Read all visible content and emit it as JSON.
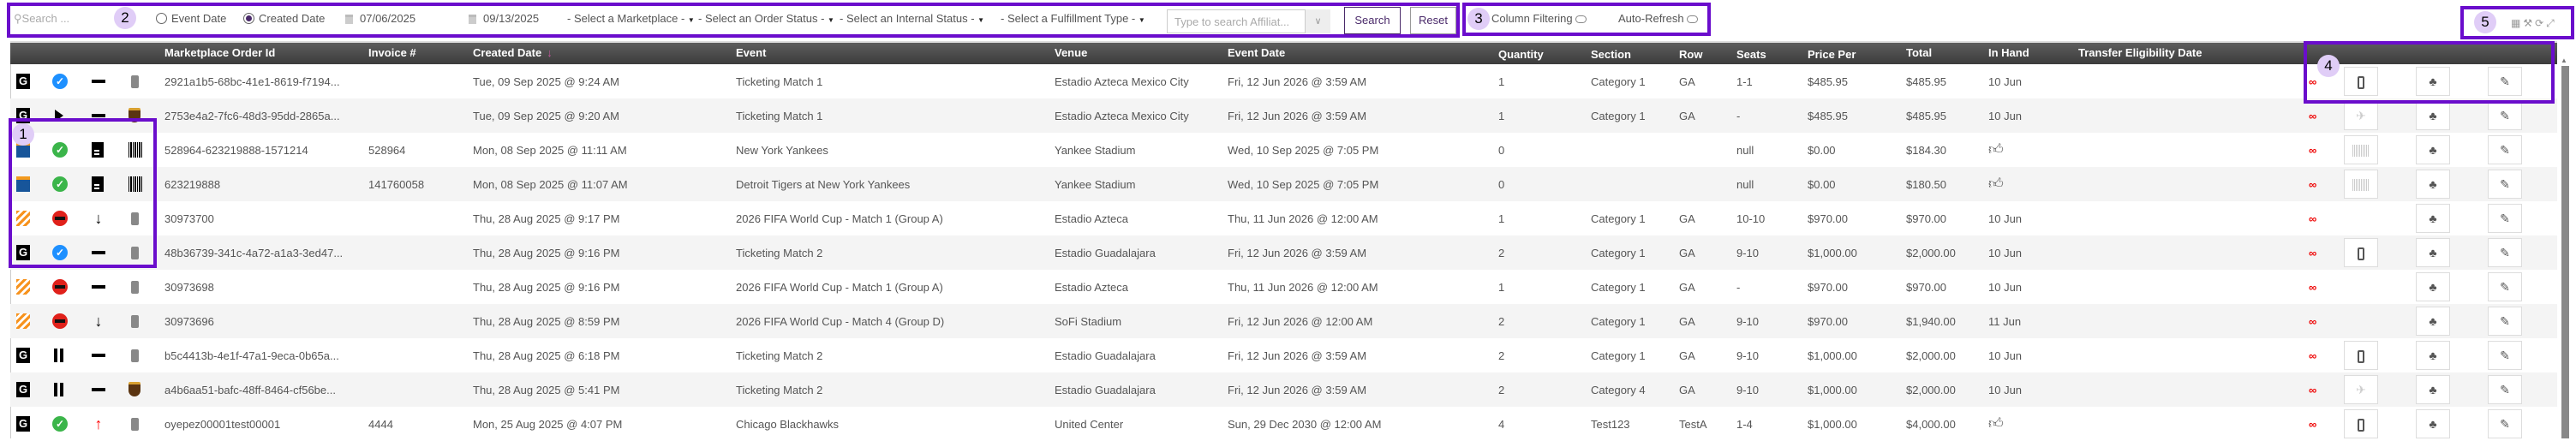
{
  "toolbar": {
    "search_placeholder": "Search ...",
    "date_type_options": [
      "Event Date",
      "Created Date"
    ],
    "date_type_selected": "Created Date",
    "date_from": "07/06/2025",
    "date_to": "09/13/2025",
    "marketplace_select": "- Select a Marketplace -",
    "order_status_select": "- Select an Order Status -",
    "internal_status_select": "- Select an Internal Status -",
    "fulfillment_type_select": "- Select a Fulfillment Type -",
    "affiliate_placeholder": "Type to search Affiliat...",
    "search_button": "Search",
    "reset_button": "Reset",
    "column_filtering_label": "Column Filtering",
    "auto_refresh_label": "Auto-Refresh",
    "tool_icons": [
      "excel-export-icon",
      "wrench-icon",
      "refresh-icon",
      "expand-icon"
    ]
  },
  "annotations": [
    "1",
    "2",
    "3",
    "4",
    "5"
  ],
  "colors": {
    "accent": "#6a0dcc",
    "header": "#4a4a4a",
    "sort": "#c0579a",
    "link": "#e00000"
  },
  "table": {
    "columns": [
      "Marketplace Order Id",
      "Invoice #",
      "Created Date",
      "Event",
      "Venue",
      "Event Date",
      "Quantity",
      "Section",
      "Row",
      "Seats",
      "Price Per",
      "Total",
      "In Hand",
      "Transfer Eligibility Date"
    ],
    "sort_column": "Created Date",
    "sort_direction": "desc",
    "rows": [
      {
        "icons": [
          "g",
          "check-blue",
          "dash",
          "phone"
        ],
        "order_id": "2921a1b5-68bc-41e1-8619-f7194...",
        "invoice": "",
        "created": "Tue, 09 Sep 2025 @ 9:24 AM",
        "event": "Ticketing Match 1",
        "venue": "Estadio Azteca Mexico City",
        "event_date": "Fri, 12 Jun 2026 @ 3:59 AM",
        "quantity": "1",
        "section": "Category 1",
        "row": "GA",
        "seats": "1-1",
        "price": "$485.95",
        "total": "$485.95",
        "in_hand": "10 Jun",
        "action": "phone"
      },
      {
        "icons": [
          "g",
          "play",
          "dash",
          "ups"
        ],
        "order_id": "2753e4a2-7fc6-48d3-95dd-2865a...",
        "invoice": "",
        "created": "Tue, 09 Sep 2025 @ 9:20 AM",
        "event": "Ticketing Match 1",
        "venue": "Estadio Azteca Mexico City",
        "event_date": "Fri, 12 Jun 2026 @ 3:59 AM",
        "quantity": "1",
        "section": "Category 1",
        "row": "GA",
        "seats": "-",
        "price": "$485.95",
        "total": "$485.95",
        "in_hand": "10 Jun",
        "action": "plane"
      },
      {
        "icons": [
          "tm",
          "check-green",
          "doc",
          "barcode"
        ],
        "order_id": "528964-623219888-1571214",
        "invoice": "528964",
        "created": "Mon, 08 Sep 2025 @ 11:11 AM",
        "event": "New York Yankees",
        "venue": "Yankee Stadium",
        "event_date": "Wed, 10 Sep 2025 @ 7:05 PM",
        "quantity": "0",
        "section": "",
        "row": "",
        "seats": "null",
        "price": "$0.00",
        "total": "$184.30",
        "in_hand": "thumbs-up",
        "action": "barcode"
      },
      {
        "icons": [
          "tm",
          "check-green",
          "doc",
          "barcode"
        ],
        "order_id": "623219888",
        "invoice": "141760058",
        "created": "Mon, 08 Sep 2025 @ 11:07 AM",
        "event": "Detroit Tigers at New York Yankees",
        "venue": "Yankee Stadium",
        "event_date": "Wed, 10 Sep 2025 @ 7:05 PM",
        "quantity": "0",
        "section": "",
        "row": "",
        "seats": "null",
        "price": "$0.00",
        "total": "$180.50",
        "in_hand": "thumbs-up",
        "action": "barcode"
      },
      {
        "icons": [
          "stripe",
          "stop-red",
          "arrow-down",
          "phone"
        ],
        "order_id": "30973700",
        "invoice": "",
        "created": "Thu, 28 Aug 2025 @ 9:17 PM",
        "event": "2026 FIFA World Cup - Match 1 (Group A)",
        "venue": "Estadio Azteca",
        "event_date": "Thu, 11 Jun 2026 @ 12:00 AM",
        "quantity": "1",
        "section": "Category 1",
        "row": "GA",
        "seats": "10-10",
        "price": "$970.00",
        "total": "$970.00",
        "in_hand": "10 Jun",
        "action": ""
      },
      {
        "icons": [
          "g",
          "check-blue",
          "dash",
          "phone"
        ],
        "order_id": "48b36739-341c-4a72-a1a3-3ed47...",
        "invoice": "",
        "created": "Thu, 28 Aug 2025 @ 9:16 PM",
        "event": "Ticketing Match 2",
        "venue": "Estadio Guadalajara",
        "event_date": "Fri, 12 Jun 2026 @ 3:59 AM",
        "quantity": "2",
        "section": "Category 1",
        "row": "GA",
        "seats": "9-10",
        "price": "$1,000.00",
        "total": "$2,000.00",
        "in_hand": "10 Jun",
        "action": "phone"
      },
      {
        "icons": [
          "stripe",
          "stop-red",
          "dash",
          "phone"
        ],
        "order_id": "30973698",
        "invoice": "",
        "created": "Thu, 28 Aug 2025 @ 9:16 PM",
        "event": "2026 FIFA World Cup - Match 1 (Group A)",
        "venue": "Estadio Azteca",
        "event_date": "Thu, 11 Jun 2026 @ 12:00 AM",
        "quantity": "1",
        "section": "Category 1",
        "row": "GA",
        "seats": "-",
        "price": "$970.00",
        "total": "$970.00",
        "in_hand": "10 Jun",
        "action": ""
      },
      {
        "icons": [
          "stripe",
          "stop-red",
          "arrow-down",
          "phone"
        ],
        "order_id": "30973696",
        "invoice": "",
        "created": "Thu, 28 Aug 2025 @ 8:59 PM",
        "event": "2026 FIFA World Cup - Match 4 (Group D)",
        "venue": "SoFi Stadium",
        "event_date": "Fri, 12 Jun 2026 @ 12:00 AM",
        "quantity": "2",
        "section": "Category 1",
        "row": "GA",
        "seats": "9-10",
        "price": "$970.00",
        "total": "$1,940.00",
        "in_hand": "11 Jun",
        "action": ""
      },
      {
        "icons": [
          "g",
          "pause",
          "dash",
          "phone"
        ],
        "order_id": "b5c4413b-4e1f-47a1-9eca-0b65a...",
        "invoice": "",
        "created": "Thu, 28 Aug 2025 @ 6:18 PM",
        "event": "Ticketing Match 2",
        "venue": "Estadio Guadalajara",
        "event_date": "Fri, 12 Jun 2026 @ 3:59 AM",
        "quantity": "2",
        "section": "Category 1",
        "row": "GA",
        "seats": "9-10",
        "price": "$1,000.00",
        "total": "$2,000.00",
        "in_hand": "10 Jun",
        "action": "phone"
      },
      {
        "icons": [
          "g",
          "pause",
          "dash",
          "ups"
        ],
        "order_id": "a4b6aa51-bafc-48ff-8464-cf56be...",
        "invoice": "",
        "created": "Thu, 28 Aug 2025 @ 5:41 PM",
        "event": "Ticketing Match 2",
        "venue": "Estadio Guadalajara",
        "event_date": "Fri, 12 Jun 2026 @ 3:59 AM",
        "quantity": "2",
        "section": "Category 4",
        "row": "GA",
        "seats": "9-10",
        "price": "$1,000.00",
        "total": "$2,000.00",
        "in_hand": "10 Jun",
        "action": "plane"
      },
      {
        "icons": [
          "g",
          "check-green",
          "arrow-up-red",
          "phone"
        ],
        "order_id": "oyepez00001test00001",
        "invoice": "4444",
        "created": "Mon, 25 Aug 2025 @ 4:07 PM",
        "event": "Chicago Blackhawks",
        "venue": "United Center",
        "event_date": "Sun, 29 Dec 2030 @ 12:00 AM",
        "quantity": "4",
        "section": "Test123",
        "row": "TestA",
        "seats": "1-4",
        "price": "$1,000.00",
        "total": "$4,000.00",
        "in_hand": "thumbs-up",
        "action": "phone"
      }
    ]
  }
}
